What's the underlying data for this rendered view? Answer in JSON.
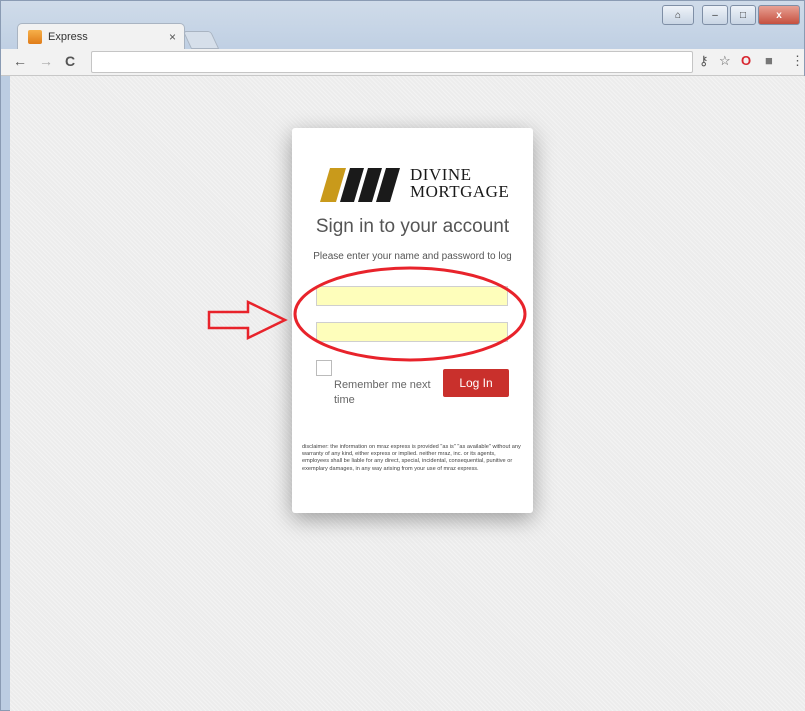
{
  "browser": {
    "tab_title": "Express",
    "tab_close": "×",
    "nav": {
      "back": "←",
      "forward": "→",
      "reload": "C"
    },
    "toolbar_icons": {
      "key": "⚷",
      "star": "☆",
      "opera": "O",
      "extension": "■",
      "menu": "⋮"
    },
    "window_controls": {
      "user": "⌂",
      "minimize": "–",
      "maximize": "□",
      "close": "x"
    },
    "address_value": ""
  },
  "login": {
    "logo": {
      "line1": "DIVINE",
      "line2": "MORTGAGE"
    },
    "title": "Sign in to your account",
    "subtitle": "Please enter your name and password to log",
    "username_value": "",
    "password_value": "",
    "remember_label": "Remember me next time",
    "login_button": "Log In",
    "disclaimer": "disclaimer: the information on mraz express is provided \"as is\" \"as available\" without any warranty of any kind, either express or implied. neither mraz, inc. or its agents, employees shall be liable for any direct, special, incidental, consequential, punitive or exemplary damages, in any way arising from your use of mraz express."
  },
  "colors": {
    "login_button": "#c9302c",
    "autofill": "#fefebb",
    "annotation_red": "#e8232b",
    "logo_gold": "#c99a1b"
  }
}
